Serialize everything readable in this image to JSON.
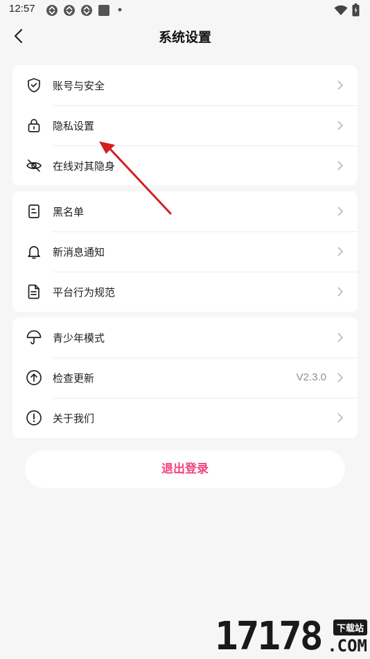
{
  "status_bar": {
    "time": "12:57",
    "icons": [
      "sync-icon",
      "sync-icon",
      "sync-icon",
      "app-square-icon",
      "dot-icon",
      "wifi-icon",
      "battery-icon"
    ]
  },
  "header": {
    "title": "系统设置",
    "back_icon": "chevron-left-icon"
  },
  "groups": [
    {
      "items": [
        {
          "label": "账号与安全",
          "icon": "shield-check-icon"
        },
        {
          "label": "隐私设置",
          "icon": "lock-icon"
        },
        {
          "label": "在线对其隐身",
          "icon": "eye-off-icon"
        }
      ]
    },
    {
      "items": [
        {
          "label": "黑名单",
          "icon": "list-doc-icon"
        },
        {
          "label": "新消息通知",
          "icon": "bell-icon"
        },
        {
          "label": "平台行为规范",
          "icon": "document-icon"
        }
      ]
    },
    {
      "items": [
        {
          "label": "青少年模式",
          "icon": "umbrella-icon"
        },
        {
          "label": "检查更新",
          "icon": "arrow-up-circle-icon",
          "value": "V2.3.0"
        },
        {
          "label": "关于我们",
          "icon": "info-circle-icon"
        }
      ]
    }
  ],
  "logout": {
    "label": "退出登录"
  },
  "colors": {
    "accent": "#f0457a",
    "arrow": "#d22020",
    "background": "#f6f6f6"
  },
  "watermark": {
    "digits": "17178",
    "tag": "下载站",
    "suffix": ".COM"
  }
}
